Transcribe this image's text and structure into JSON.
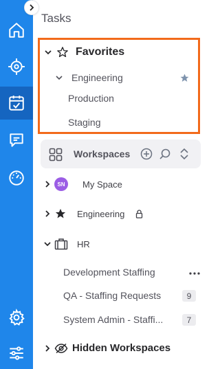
{
  "panel": {
    "title": "Tasks"
  },
  "rail": {
    "items": [
      {
        "name": "home-icon",
        "active": false
      },
      {
        "name": "crosshair-icon",
        "active": false
      },
      {
        "name": "tasks-calendar-icon",
        "active": true
      },
      {
        "name": "chat-icon",
        "active": false
      },
      {
        "name": "dashboard-gauge-icon",
        "active": false
      }
    ],
    "bottom_items": [
      {
        "name": "gear-icon"
      },
      {
        "name": "sliders-icon"
      }
    ]
  },
  "favorites": {
    "label": "Favorites",
    "items": [
      {
        "label": "Engineering",
        "starred": true
      },
      {
        "label": "Production"
      },
      {
        "label": "Staging"
      }
    ]
  },
  "workspaces": {
    "label": "Workspaces",
    "items": [
      {
        "label": "My Space",
        "avatar": "SN"
      },
      {
        "label": "Engineering",
        "locked": true
      },
      {
        "label": "HR",
        "expanded": true
      }
    ],
    "hr_children": [
      {
        "label": "Development Staffing",
        "count": ""
      },
      {
        "label": "QA - Staffing Requests",
        "count": "9"
      },
      {
        "label": "System Admin - Staffi...",
        "count": "7"
      }
    ]
  },
  "hidden_workspaces": {
    "label": "Hidden Workspaces"
  },
  "colors": {
    "rail": "#1f86ea",
    "rail_active": "#1565c0",
    "highlight": "#f26a1b",
    "avatar": "#9b5de5"
  }
}
